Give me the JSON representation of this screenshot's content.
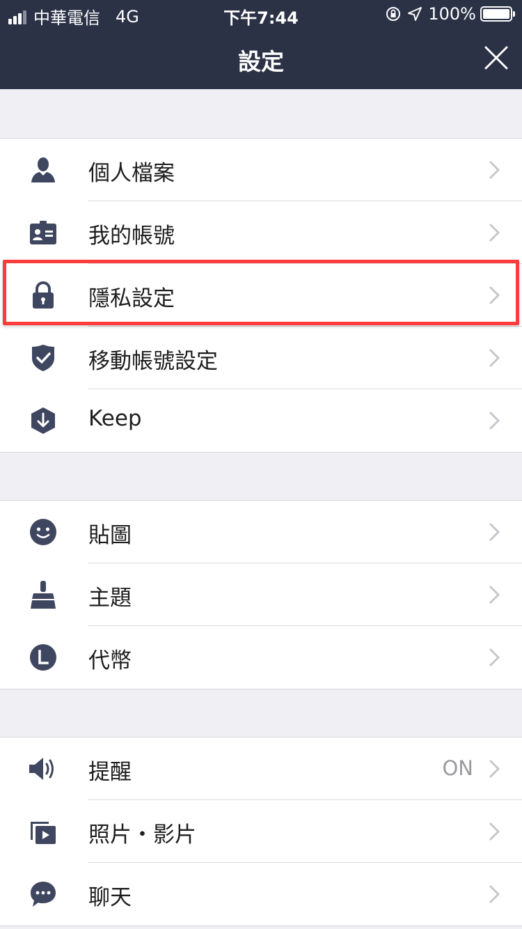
{
  "status_bar": {
    "carrier": "中華電信",
    "network": "4G",
    "time": "下午7:44",
    "battery": "100%"
  },
  "nav": {
    "title": "設定"
  },
  "sections": [
    {
      "items": [
        {
          "label": "個人檔案",
          "icon": "person-icon"
        },
        {
          "label": "我的帳號",
          "icon": "id-card-icon"
        },
        {
          "label": "隱私設定",
          "icon": "lock-icon"
        },
        {
          "label": "移動帳號設定",
          "icon": "shield-check-icon"
        },
        {
          "label": "Keep",
          "icon": "keep-download-icon"
        }
      ]
    },
    {
      "items": [
        {
          "label": "貼圖",
          "icon": "smiley-icon"
        },
        {
          "label": "主題",
          "icon": "brush-icon"
        },
        {
          "label": "代幣",
          "icon": "coin-icon"
        }
      ]
    },
    {
      "items": [
        {
          "label": "提醒",
          "icon": "speaker-icon",
          "value": "ON"
        },
        {
          "label": "照片・影片",
          "icon": "media-icon"
        },
        {
          "label": "聊天",
          "icon": "chat-bubble-icon"
        }
      ]
    }
  ],
  "colors": {
    "nav_bg": "#2b3246",
    "icon": "#3f4660",
    "highlight": "#ff3b3b"
  }
}
